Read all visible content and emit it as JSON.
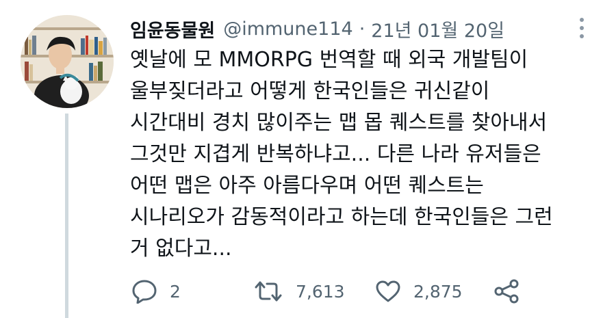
{
  "tweet": {
    "display_name": "임윤동물원",
    "handle": "@immune114",
    "separator": "·",
    "date": "21년 01월 20일",
    "lines": [
      "옛날에 모 MMORPG 번역할 때 외국 개발팀이",
      "울부짖더라고 어떻게 한국인들은 귀신같이",
      "시간대비 경치 많이주는 맵 몹 퀘스트를 찾아내서",
      "그것만 지겹게 반복하냐고... 다른 나라 유저들은",
      "어떤 맵은 아주 아름다우며 어떤 퀘스트는",
      "시나리오가 감동적이라고 하는데 한국인들은 그런",
      "거 없다고..."
    ],
    "stats": {
      "replies": "2",
      "retweets": "7,613",
      "likes": "2,875"
    }
  },
  "icons": {
    "more": "more-vertical-icon",
    "reply": "reply-icon",
    "retweet": "retweet-icon",
    "like": "heart-icon",
    "share": "share-icon"
  },
  "colors": {
    "text": "#0f1419",
    "muted": "#536471",
    "thread_line": "#cfd9de"
  }
}
